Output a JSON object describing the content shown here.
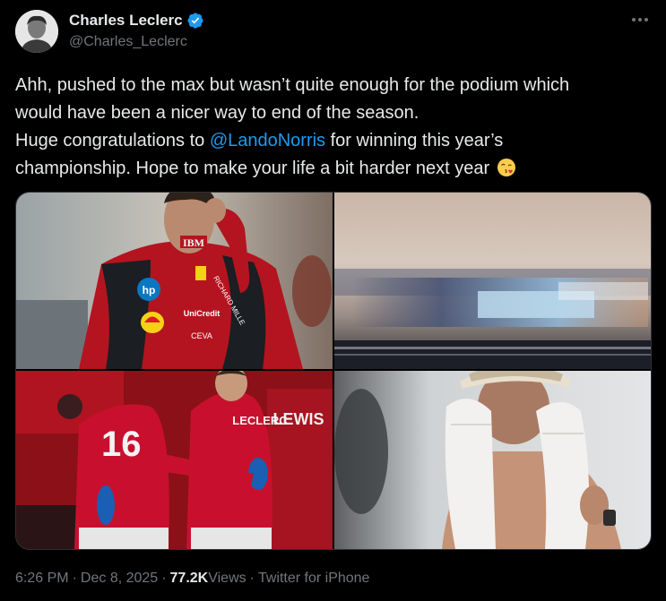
{
  "author": {
    "display_name": "Charles Leclerc",
    "handle": "@Charles_Leclerc",
    "verified": true
  },
  "tweet": {
    "line1": "Ahh, pushed to the max but wasn’t quite enough for the podium which",
    "line2": "would have been a nicer way to end of the season.",
    "line3_prefix": "Huge congratulations to ",
    "mention": "@LandoNorris",
    "line3_suffix": " for winning this year’s",
    "line4": "championship. Hope to make your life a bit harder next year",
    "emoji": "face-blowing-a-kiss"
  },
  "media": {
    "photos": [
      {
        "label": "driver-race-suit-photo",
        "text_on_suit": [
          "IBM",
          "hp",
          "UniCredit",
          "CEVA",
          "RICHARD MILLE"
        ]
      },
      {
        "label": "motion-blur-track-photo"
      },
      {
        "label": "drivers-back-view-photo",
        "text_on_suits": [
          "16",
          "LECLERC",
          "LEWIS"
        ]
      },
      {
        "label": "driver-with-towel-photo"
      }
    ]
  },
  "meta": {
    "time": "6:26 PM",
    "date": "Dec 8, 2025",
    "views_count": "77.2K",
    "views_label": " Views",
    "source": "Twitter for iPhone",
    "separator": "·"
  },
  "colors": {
    "background": "#000000",
    "text": "#e7e9ea",
    "secondary": "#71767b",
    "accent": "#1d9bf0",
    "ferrari_red": "#c8102e"
  }
}
